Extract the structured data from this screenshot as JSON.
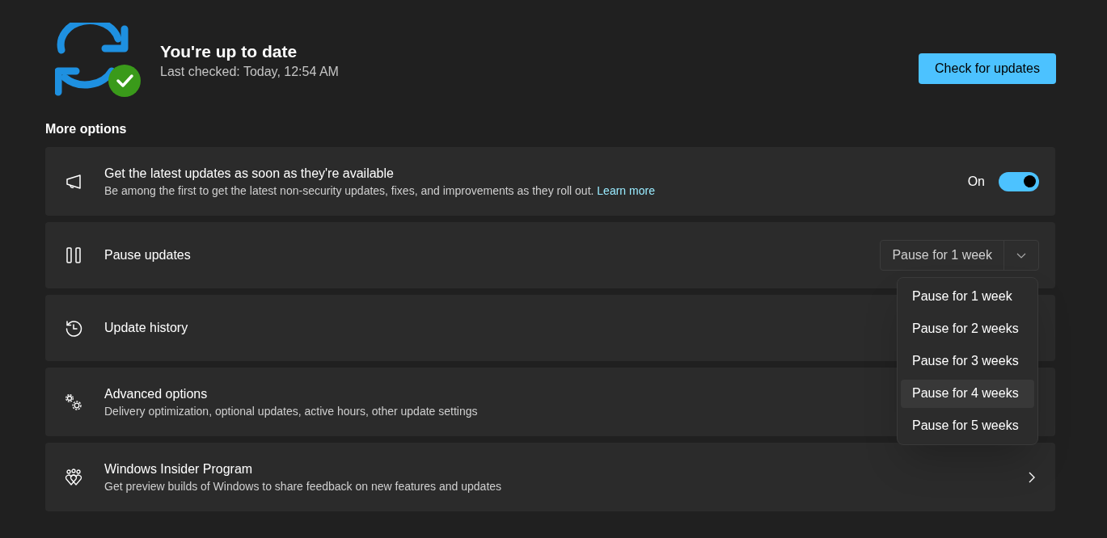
{
  "status": {
    "title": "You're up to date",
    "subtitle": "Last checked: Today, 12:54 AM",
    "button": "Check for updates"
  },
  "section_title": "More options",
  "options": [
    {
      "title": "Get the latest updates as soon as they're available",
      "description": "Be among the first to get the latest non-security updates, fixes, and improvements as they roll out.",
      "link": "Learn more",
      "control": {
        "kind": "toggle",
        "label": "On",
        "on": true
      }
    },
    {
      "title": "Pause updates",
      "control": {
        "kind": "dropdown",
        "value": "Pause for 1 week",
        "options": [
          {
            "label": "Pause for 1 week",
            "highlighted": false
          },
          {
            "label": "Pause for 2 weeks",
            "highlighted": false
          },
          {
            "label": "Pause for 3 weeks",
            "highlighted": false
          },
          {
            "label": "Pause for 4 weeks",
            "highlighted": true
          },
          {
            "label": "Pause for 5 weeks",
            "highlighted": false
          }
        ]
      }
    },
    {
      "title": "Update history",
      "control": {
        "kind": "none"
      }
    },
    {
      "title": "Advanced options",
      "description": "Delivery optimization, optional updates, active hours, other update settings",
      "control": {
        "kind": "none"
      }
    },
    {
      "title": "Windows Insider Program",
      "description": "Get preview builds of Windows to share feedback on new features and updates",
      "control": {
        "kind": "chevron"
      }
    }
  ]
}
